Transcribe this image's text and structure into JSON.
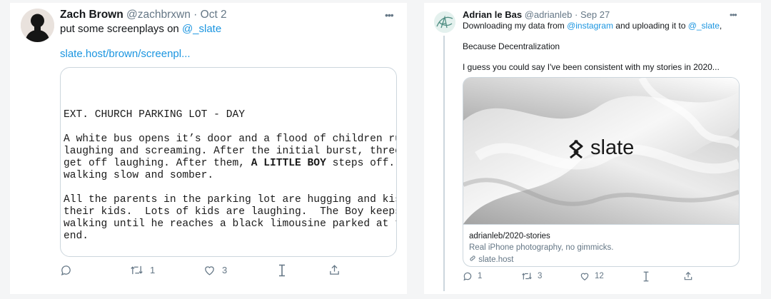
{
  "tweet1": {
    "author_name": "Zach Brown",
    "author_handle": "@zachbrxwn",
    "separator": "·",
    "date": "Oct 2",
    "text_prefix": "put some screenplays on ",
    "mention": "@_slate",
    "url": "slate.host/brown/screenpl...",
    "screenplay": {
      "heading": "EXT. CHURCH PARKING LOT - DAY",
      "p1_line1": "A white bus opens it’s door and a flood of children run off",
      "p1_line2": "laughing and screaming. After the initial burst, three girls",
      "p1_line3a": "get off laughing. After them, ",
      "p1_line3_bold": "A LITTLE BOY",
      "p1_line3b": " steps off. He’s",
      "p1_line4": "walking slow and somber.",
      "p2_line1": "All the parents in the parking lot are hugging and kissing",
      "p2_line2": "their kids.  Lots of kids are laughing.  The Boy keeps",
      "p2_line3": "walking until he reaches a black limousine parked at the far",
      "p2_line4": "end."
    },
    "retweet_count": "1",
    "like_count": "3",
    "icons": [
      "reply-icon",
      "retweet-icon",
      "like-icon",
      "tip-icon",
      "share-icon",
      "more-icon"
    ]
  },
  "tweet2": {
    "author_name": "Adrian le Bas",
    "author_handle": "@adrianleb",
    "separator": "·",
    "date": "Sep 27",
    "line1_prefix": "Downloading my data from ",
    "line1_mention1": "@instagram",
    "line1_middle": " and uploading it to ",
    "line1_mention2": "@_slate",
    "line1_suffix": ",",
    "line2": "Because Decentralization",
    "line3": "I guess you could say I've been consistent with my stories in 2020...",
    "card": {
      "brand": "slate",
      "title": "adrianleb/2020-stories",
      "description": "Real iPhone photography, no gimmicks.",
      "host": "slate.host"
    },
    "reply_count": "1",
    "retweet_count": "3",
    "like_count": "12",
    "icons": [
      "reply-icon",
      "retweet-icon",
      "like-icon",
      "tip-icon",
      "share-icon",
      "more-icon",
      "link-icon"
    ]
  },
  "colors": {
    "accent_link": "#1b95e0",
    "secondary_text": "#657786",
    "border": "#ccd6dd",
    "background": "#f4f5f6"
  }
}
